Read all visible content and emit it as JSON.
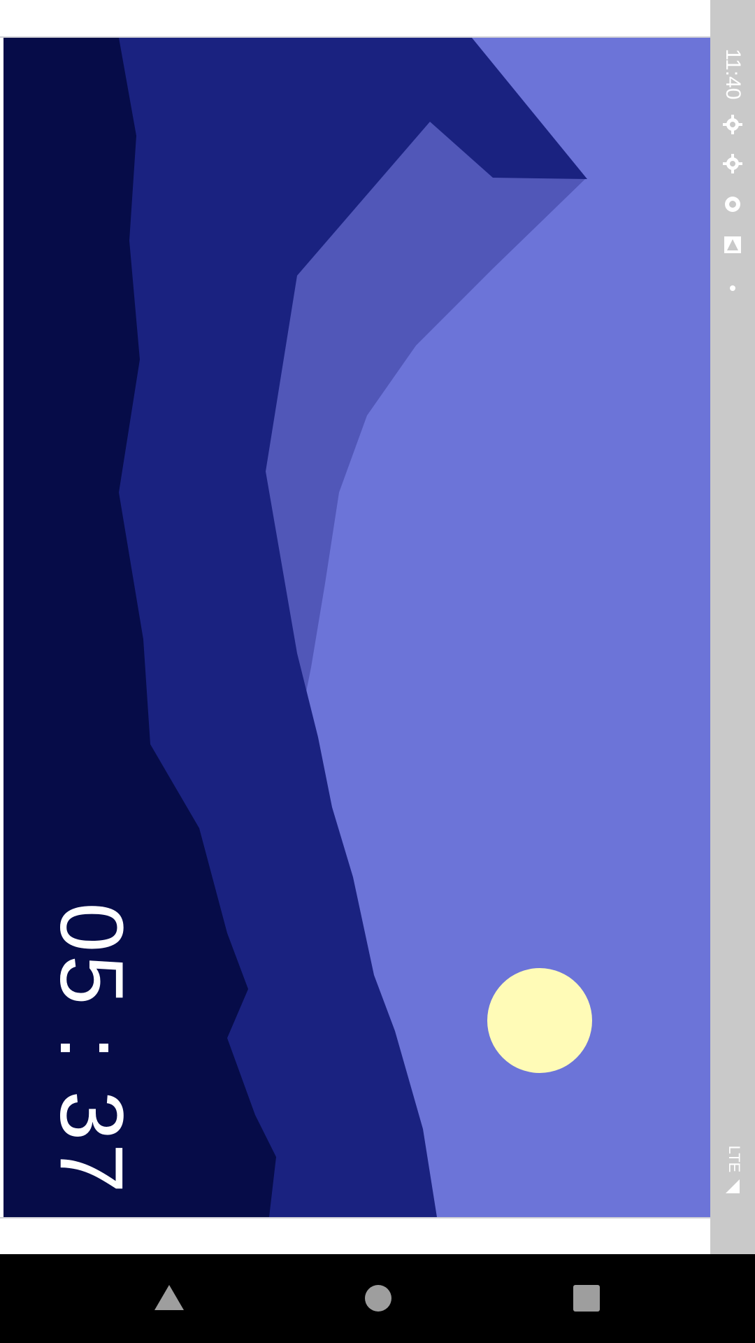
{
  "status_bar": {
    "time": "11:40",
    "network": "LTE",
    "icons": [
      "gear-icon",
      "gear-icon",
      "sync-icon",
      "notification-a-icon",
      "dot-icon",
      "signal-icon",
      "battery-icon"
    ]
  },
  "wallpaper": {
    "clock": "05 : 37",
    "colors": {
      "sky": "#6c74d8",
      "far_mountain": "#5157b8",
      "mid_mountain": "#1a2280",
      "near_mountain": "#060c48",
      "moon": "#fffbb7"
    }
  },
  "navigation": {
    "buttons": [
      "back-button",
      "home-button",
      "recents-button"
    ]
  }
}
